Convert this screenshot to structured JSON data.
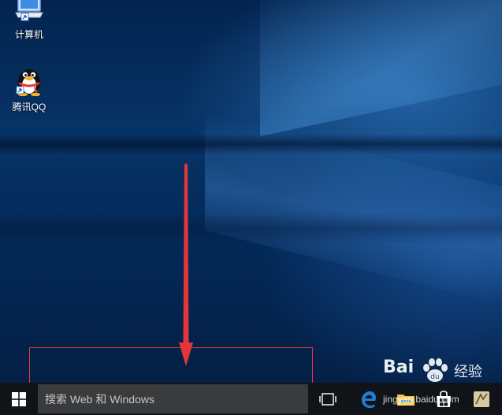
{
  "desktop": {
    "icons": [
      {
        "label": "计算机",
        "icon": "computer-icon"
      },
      {
        "label": "腾讯QQ",
        "icon": "qq-penguin-icon"
      }
    ]
  },
  "taskbar": {
    "search_placeholder": "搜索 Web 和 Windows",
    "apps": [
      "task-view-icon",
      "edge-icon",
      "file-explorer-icon",
      "store-icon",
      "app-icon"
    ]
  },
  "watermark": {
    "brand": "Bai",
    "brand_cn": "经验",
    "url": "jingyan.baidu.com"
  },
  "colors": {
    "annotation": "#e2363a",
    "taskbar": "#101418",
    "search_box": "#3a3b3d",
    "edge_blue": "#1e7fd8"
  }
}
